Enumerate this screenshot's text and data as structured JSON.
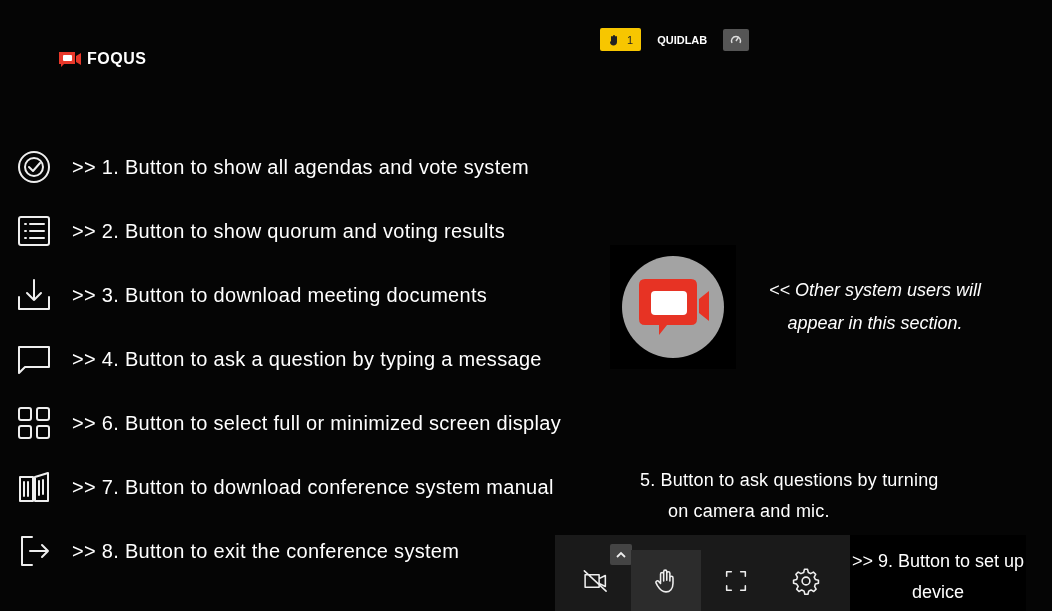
{
  "header": {
    "logo": "FOQUS",
    "raised_hands": "1",
    "room": "QUIDLAB"
  },
  "menu": [
    {
      "kind": "check",
      "note": ">> 1. Button to show all agendas and vote system"
    },
    {
      "kind": "list",
      "note": ">> 2. Button to show quorum and voting results"
    },
    {
      "kind": "download",
      "note": ">> 3. Button to download meeting documents"
    },
    {
      "kind": "chat",
      "note": ">> 4. Button to ask a question by typing a message"
    },
    {
      "kind": "grid",
      "note": ">> 6. Button to select full or minimized screen display"
    },
    {
      "kind": "book",
      "note": ">> 7. Button to download conference system manual"
    },
    {
      "kind": "exit",
      "note": ">> 8. Button to exit the conference system"
    }
  ],
  "participant_note": "<< Other system users will appear in this section.",
  "camera_note": "5. Button to ask questions by turning on camera and mic.",
  "toolbar": [
    {
      "kind": "camera-off",
      "selected": false,
      "caret": true
    },
    {
      "kind": "hand",
      "selected": true,
      "caret": false
    },
    {
      "kind": "fullscreen",
      "selected": false,
      "caret": false
    },
    {
      "kind": "settings",
      "selected": false,
      "caret": false
    }
  ],
  "device_note": ">> 9. Button to set up device"
}
